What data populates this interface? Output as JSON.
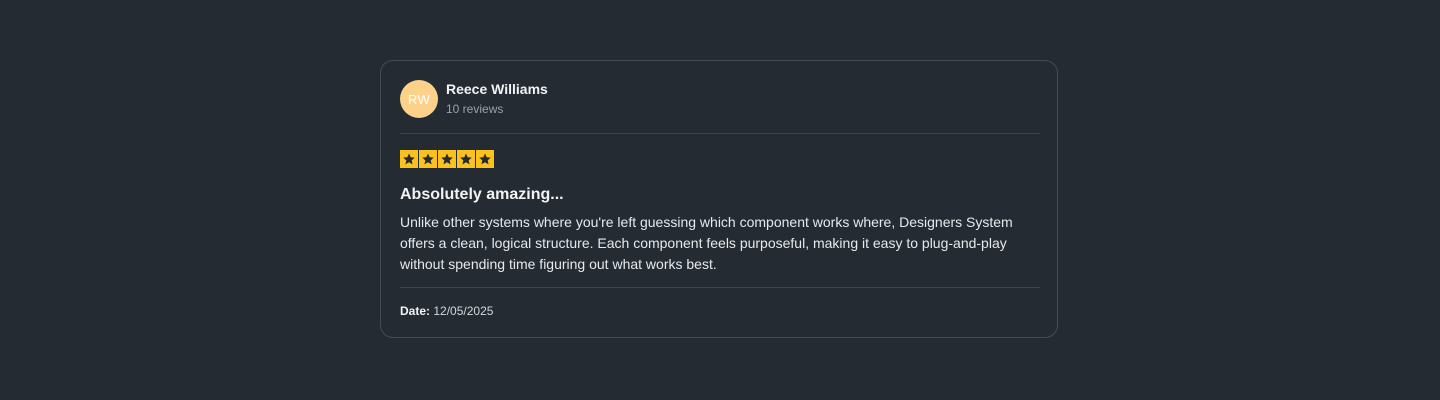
{
  "reviewer": {
    "initials": "RW",
    "name": "Reece Williams",
    "review_count": "10 reviews",
    "avatar_color": "#fcd28b"
  },
  "rating": {
    "value": 5,
    "max": 5,
    "star_color": "#fbc21f",
    "icon": "star-icon"
  },
  "review": {
    "title": "Absolutely amazing...",
    "body": "Unlike other systems where you're left guessing which component works where, Designers System offers a clean, logical structure. Each component feels purposeful, making it easy to plug-and-play without spending time figuring out what works best."
  },
  "footer": {
    "date_label": "Date:",
    "date_value": "12/05/2025"
  },
  "theme": {
    "background": "#252b32",
    "border": "#454b53"
  }
}
